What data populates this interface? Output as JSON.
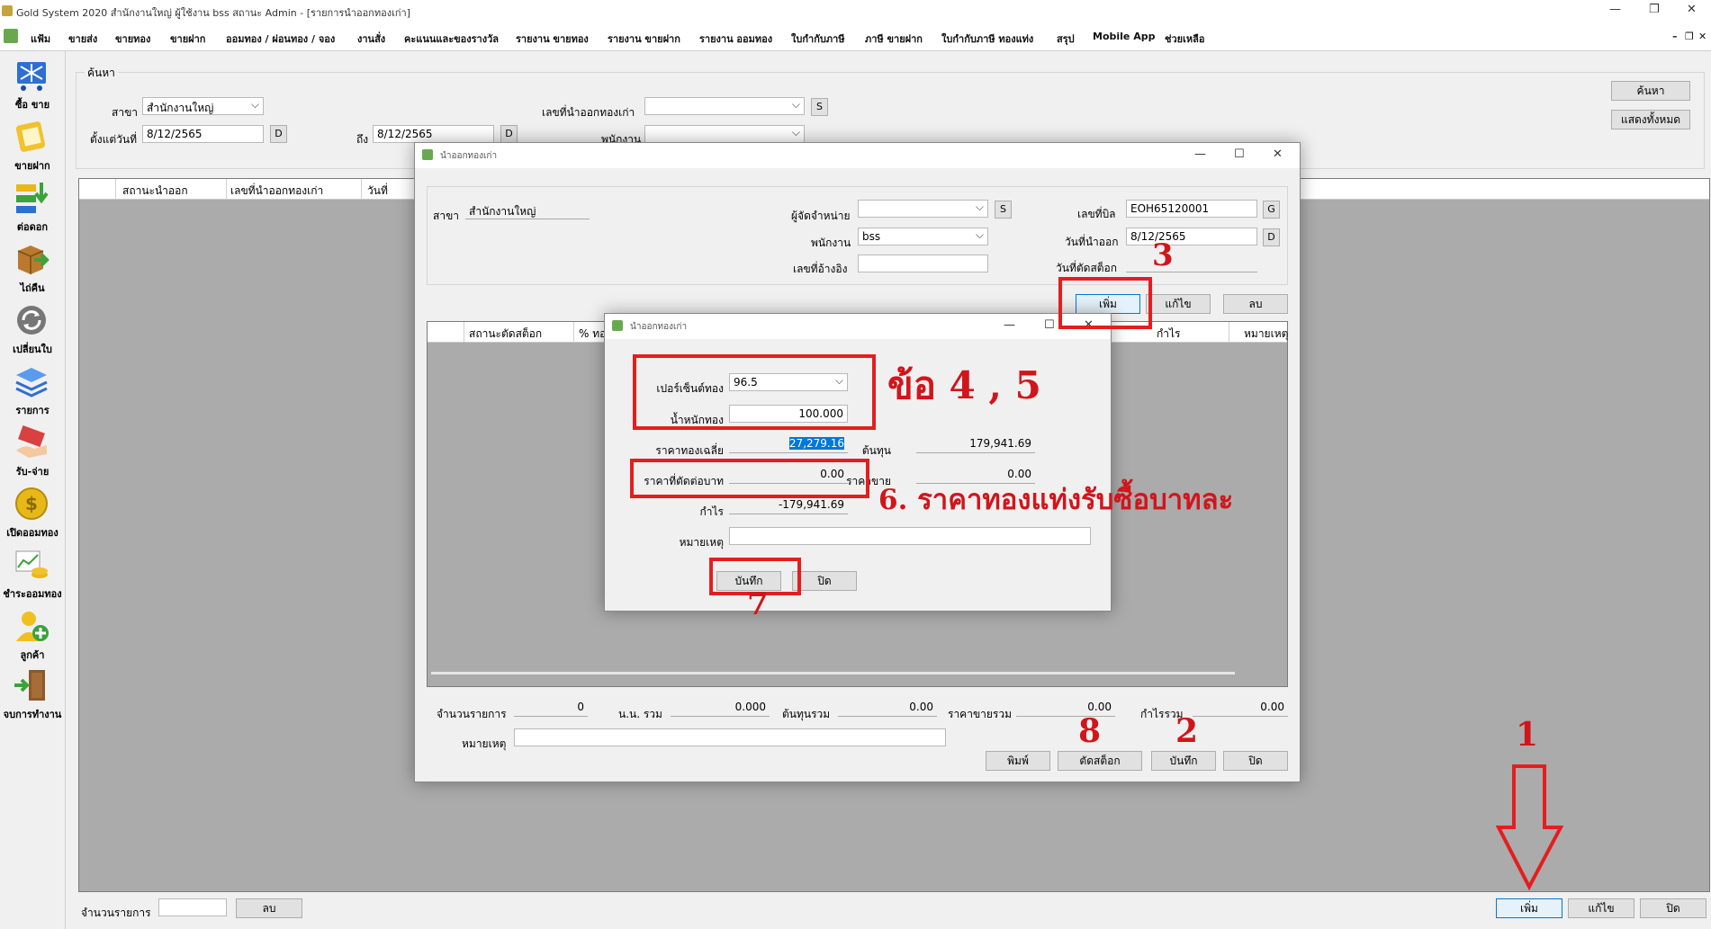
{
  "window": {
    "title": "Gold System 2020  สำนักงานใหญ่ ผู้ใช้งาน bss สถานะ Admin - [รายการนำออกทองเก่า]",
    "controls": [
      "—",
      "❐",
      "✕"
    ]
  },
  "menu": {
    "items": [
      "แฟ้ม",
      "ขายส่ง",
      "ขายทอง",
      "ขายฝาก",
      "ออมทอง / ผ่อนทอง / จอง",
      "งานสั่ง",
      "คะแนนและของรางวัล",
      "รายงาน ขายทอง",
      "รายงาน ขายฝาก",
      "รายงาน ออมทอง",
      "ใบกำกับภาษี",
      "ภาษี ขายฝาก",
      "ใบกำกับภาษี ทองแท่ง",
      "สรุป",
      "Mobile App",
      "ช่วยเหลือ"
    ],
    "mdi_controls": [
      "–",
      "❐",
      "✕"
    ]
  },
  "sidebar": {
    "items": [
      {
        "label": "ซื้อ ขาย",
        "icon": "cart-icon",
        "color": "#2f6fd1"
      },
      {
        "label": "ขายฝาก",
        "icon": "pawn-bag-icon",
        "color": "#f2c12e"
      },
      {
        "label": "ต่อดอก",
        "icon": "arrow-down-stack-icon",
        "color": "#3aa33a"
      },
      {
        "label": "ไถ่คืน",
        "icon": "box-arrow-icon",
        "color": "#b97a2f"
      },
      {
        "label": "เปลี่ยนใบ",
        "icon": "refresh-icon",
        "color": "#555555"
      },
      {
        "label": "รายการ",
        "icon": "layers-icon",
        "color": "#2f6fd1"
      },
      {
        "label": "รับ-จ่าย",
        "icon": "money-hand-icon",
        "color": "#d94040"
      },
      {
        "label": "เปิดออมทอง",
        "icon": "gold-coin-icon",
        "color": "#e8b818"
      },
      {
        "label": "ชำระออมทอง",
        "icon": "chart-coins-icon",
        "color": "#3aa33a"
      },
      {
        "label": "ลูกค้า",
        "icon": "add-user-icon",
        "color": "#3aa33a"
      },
      {
        "label": "จบการทำงาน",
        "icon": "exit-door-icon",
        "color": "#8b5a2b"
      }
    ]
  },
  "search": {
    "group_caption": "ค้นหา",
    "branch_label": "สาขา",
    "branch_value": "สำนักงานใหญ่",
    "from_date_label": "ตั้งแต่วันที่",
    "from_date_value": "8/12/2565",
    "date_button": "D",
    "to_label": "ถึง",
    "to_value": "8/12/2565",
    "doc_no_label": "เลขที่นำออกทองเก่า",
    "doc_no_value": "",
    "s_button": "S",
    "employee_label": "พนักงาน",
    "employee_value": "",
    "search_button": "ค้นหา",
    "show_all_button": "แสดงทั้งหมด"
  },
  "main_grid": {
    "columns": [
      "สถานะนำออก",
      "เลขที่นำออกทองเก่า",
      "วันที่"
    ]
  },
  "bottom": {
    "count_label": "จำนวนรายการ",
    "count_value": "",
    "delete_button": "ลบ",
    "add_button": "เพิ่ม",
    "edit_button": "แก้ไข",
    "close_button": "ปิด"
  },
  "dialog1": {
    "title": "นำออกทองเก่า",
    "branch_label": "สาขา",
    "branch_value": "สำนักงานใหญ่",
    "distributor_label": "ผู้จัดจำหน่าย",
    "distributor_value": "",
    "s_button": "S",
    "employee_label": "พนักงาน",
    "employee_value": "bss",
    "ref_label": "เลขที่อ้างอิง",
    "ref_value": "",
    "bill_no_label": "เลขที่บิล",
    "bill_no_value": "EOH65120001",
    "g_button": "G",
    "out_date_label": "วันที่นำออก",
    "out_date_value": "8/12/2565",
    "d_button": "D",
    "cut_date_label": "วันที่ตัดสต็อก",
    "cut_date_value": "",
    "add_button": "เพิ่ม",
    "edit_button": "แก้ไข",
    "delete_button": "ลบ",
    "grid_columns": [
      "สถานะตัดสต็อก",
      "% ทอ",
      "กำไร",
      "หมายเหตุ"
    ],
    "total_count_label": "จำนวนรายการ",
    "total_count_value": "0",
    "total_weight_label": "น.น. รวม",
    "total_weight_value": "0.000",
    "total_cost_label": "ต้นทุนรวม",
    "total_cost_value": "0.00",
    "total_sell_label": "ราคาขายรวม",
    "total_sell_value": "0.00",
    "total_profit_label": "กำไรรวม",
    "total_profit_value": "0.00",
    "note_label": "หมายเหตุ",
    "note_value": "",
    "print_button": "พิมพ์",
    "cut_stock_button": "ตัดสต็อก",
    "save_button": "บันทึก",
    "close_button": "ปิด"
  },
  "dialog2": {
    "title": "นำออกทองเก่า",
    "percent_label": "เปอร์เซ็นต์ทอง",
    "percent_value": "96.5",
    "weight_label": "น้ำหนักทอง",
    "weight_value": "100.000",
    "avg_price_label": "ราคาทองเฉลี่ย",
    "avg_price_value": "27,279.16",
    "cost_label": "ต้นทุน",
    "cost_value": "179,941.69",
    "cut_price_label": "ราคาที่ตัดต่อบาท",
    "cut_price_value": "0.00",
    "sell_price_label": "ราคาขาย",
    "sell_price_value": "0.00",
    "profit_label": "กำไร",
    "profit_value": "-179,941.69",
    "note_label": "หมายเหตุ",
    "note_value": "",
    "save_button": "บันทึก",
    "close_button": "ปิด"
  },
  "annotations": {
    "step1": "1",
    "step2": "2",
    "step3": "3",
    "step45": "ข้อ 4 , 5",
    "step6": "6. ราคาทองแท่งรับซื้อบาทละ",
    "step7": "7",
    "step8": "8",
    "color": "#e41e1e"
  }
}
